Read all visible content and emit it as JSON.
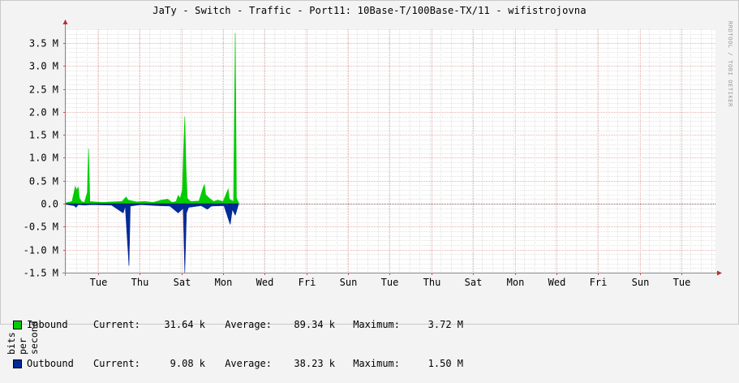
{
  "chart_data": {
    "type": "area",
    "title": "JaTy - Switch - Traffic - Port11: 10Base-T/100Base-TX/11 - wifistrojovna",
    "ylabel": "bits per second",
    "xlabel": "",
    "side_credit": "RRDTOOL / TOBI OETIKER",
    "ylim": [
      -1.5,
      3.8
    ],
    "yunit": "M",
    "yticks": [
      {
        "value": 3.5,
        "label": "3.5 M"
      },
      {
        "value": 3.0,
        "label": "3.0 M"
      },
      {
        "value": 2.5,
        "label": "2.5 M"
      },
      {
        "value": 2.0,
        "label": "2.0 M"
      },
      {
        "value": 1.5,
        "label": "1.5 M"
      },
      {
        "value": 1.0,
        "label": "1.0 M"
      },
      {
        "value": 0.5,
        "label": "0.5 M"
      },
      {
        "value": 0.0,
        "label": "0.0"
      },
      {
        "value": -0.5,
        "label": "-0.5 M"
      },
      {
        "value": -1.0,
        "label": "-1.0 M"
      },
      {
        "value": -1.5,
        "label": "-1.5 M"
      }
    ],
    "xlim": [
      0,
      15.6
    ],
    "x_unit": "days",
    "xticks": [
      {
        "value": 0.78,
        "label": "Tue"
      },
      {
        "value": 1.78,
        "label": "Thu"
      },
      {
        "value": 2.78,
        "label": "Sat"
      },
      {
        "value": 3.78,
        "label": "Mon"
      },
      {
        "value": 4.78,
        "label": "Wed"
      },
      {
        "value": 5.78,
        "label": "Fri"
      },
      {
        "value": 6.78,
        "label": "Sun"
      },
      {
        "value": 7.78,
        "label": "Tue"
      },
      {
        "value": 8.78,
        "label": "Thu"
      },
      {
        "value": 9.78,
        "label": "Sat"
      },
      {
        "value": 10.78,
        "label": "Mon"
      },
      {
        "value": 11.78,
        "label": "Wed"
      },
      {
        "value": 12.78,
        "label": "Fri"
      },
      {
        "value": 13.78,
        "label": "Sun"
      },
      {
        "value": 14.78,
        "label": "Tue"
      }
    ],
    "grid": true,
    "series": [
      {
        "name": "Inbound",
        "color": "#00cc00",
        "points": [
          [
            0.0,
            0.02
          ],
          [
            0.15,
            0.05
          ],
          [
            0.2,
            0.25
          ],
          [
            0.23,
            0.38
          ],
          [
            0.26,
            0.3
          ],
          [
            0.3,
            0.36
          ],
          [
            0.33,
            0.12
          ],
          [
            0.38,
            0.05
          ],
          [
            0.45,
            0.03
          ],
          [
            0.52,
            0.25
          ],
          [
            0.55,
            1.2
          ],
          [
            0.58,
            0.05
          ],
          [
            0.7,
            0.04
          ],
          [
            0.9,
            0.03
          ],
          [
            1.1,
            0.04
          ],
          [
            1.35,
            0.05
          ],
          [
            1.45,
            0.15
          ],
          [
            1.5,
            0.08
          ],
          [
            1.7,
            0.04
          ],
          [
            1.9,
            0.05
          ],
          [
            2.1,
            0.03
          ],
          [
            2.3,
            0.08
          ],
          [
            2.45,
            0.1
          ],
          [
            2.55,
            0.03
          ],
          [
            2.65,
            0.05
          ],
          [
            2.7,
            0.18
          ],
          [
            2.75,
            0.12
          ],
          [
            2.8,
            0.3
          ],
          [
            2.83,
            1.15
          ],
          [
            2.86,
            1.9
          ],
          [
            2.89,
            0.75
          ],
          [
            2.92,
            0.12
          ],
          [
            3.0,
            0.05
          ],
          [
            3.2,
            0.06
          ],
          [
            3.3,
            0.35
          ],
          [
            3.33,
            0.42
          ],
          [
            3.36,
            0.2
          ],
          [
            3.45,
            0.12
          ],
          [
            3.55,
            0.05
          ],
          [
            3.65,
            0.08
          ],
          [
            3.78,
            0.05
          ],
          [
            3.9,
            0.32
          ],
          [
            3.93,
            0.1
          ],
          [
            4.03,
            0.05
          ],
          [
            4.07,
            3.72
          ],
          [
            4.1,
            0.12
          ],
          [
            4.15,
            0.03
          ]
        ]
      },
      {
        "name": "Outbound",
        "color": "#002a97",
        "points": [
          [
            0.0,
            -0.01
          ],
          [
            0.2,
            -0.04
          ],
          [
            0.25,
            -0.08
          ],
          [
            0.3,
            -0.02
          ],
          [
            0.45,
            -0.03
          ],
          [
            0.6,
            -0.02
          ],
          [
            1.1,
            -0.03
          ],
          [
            1.38,
            -0.2
          ],
          [
            1.43,
            -0.05
          ],
          [
            1.52,
            -1.35
          ],
          [
            1.55,
            -0.05
          ],
          [
            1.8,
            -0.02
          ],
          [
            2.2,
            -0.04
          ],
          [
            2.5,
            -0.05
          ],
          [
            2.7,
            -0.2
          ],
          [
            2.82,
            -0.1
          ],
          [
            2.86,
            -1.5
          ],
          [
            2.9,
            -0.2
          ],
          [
            2.95,
            -0.08
          ],
          [
            3.25,
            -0.04
          ],
          [
            3.4,
            -0.12
          ],
          [
            3.5,
            -0.05
          ],
          [
            3.8,
            -0.04
          ],
          [
            3.95,
            -0.45
          ],
          [
            4.0,
            -0.12
          ],
          [
            4.07,
            -0.25
          ],
          [
            4.15,
            -0.01
          ]
        ]
      }
    ],
    "legend": [
      {
        "name": "Inbound",
        "color": "#00cc00",
        "current_label": "Current:",
        "current": "31.64 k",
        "average_label": "Average:",
        "average": "89.34 k",
        "maximum_label": "Maximum:",
        "maximum": "3.72 M"
      },
      {
        "name": "Outbound",
        "color": "#002a97",
        "current_label": "Current:",
        "current": "9.08 k",
        "average_label": "Average:",
        "average": "38.23 k",
        "maximum_label": "Maximum:",
        "maximum": "1.50 M"
      }
    ]
  }
}
